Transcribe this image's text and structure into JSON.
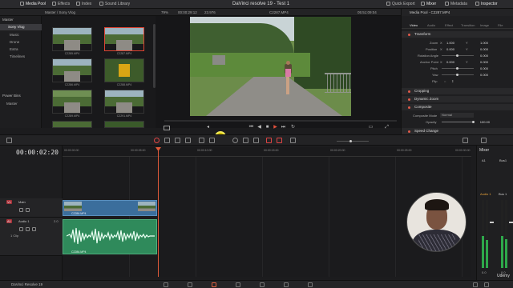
{
  "topbar": {
    "media_pool": "Media Pool",
    "effects": "Effects",
    "index": "Index",
    "sound_library": "Sound Library",
    "app_title": "DaVinci resolve 19 - Test 1",
    "quick_export": "Quick Export",
    "mixer": "Mixer",
    "metadata": "Metadata",
    "inspector": "Inspector"
  },
  "subbar": {
    "breadcrumb": "Master / Sony Vlog",
    "zoom": "79%",
    "timecode_in": "00:00:29:12",
    "fps": "23.976",
    "clip_name": "C2287.MP4",
    "timecode_out": "05:51:09:04"
  },
  "bins": {
    "master": "Master",
    "selected": "Sony Vlog",
    "items": [
      "Music",
      "Drone",
      "Extra",
      "Timelines"
    ],
    "power_bins": "Power Bins",
    "power_master": "Master"
  },
  "pool": {
    "thumbs": [
      "C2285.MP4",
      "C2287.MP4",
      "C2286.MP4",
      "C2288.MP4",
      "C2289.MP4",
      "C2291.MP4"
    ]
  },
  "inspector": {
    "header": "Media Pool - C2287.MP4",
    "tabs": [
      "Video",
      "Audio",
      "Effect",
      "Transition",
      "Image",
      "File"
    ],
    "transform": "Transform",
    "zoom_label": "Zoom",
    "zoom_x": "1.000",
    "zoom_y": "1.000",
    "position_label": "Position",
    "pos_x": "0.000",
    "pos_y": "0.000",
    "rotation_label": "Rotation Angle",
    "rotation": "0.000",
    "anchor_label": "Anchor Point",
    "anchor_x": "0.000",
    "anchor_y": "0.000",
    "pitch_label": "Pitch",
    "pitch": "0.000",
    "yaw_label": "Yaw",
    "yaw": "0.000",
    "flip_label": "Flip",
    "cropping": "Cropping",
    "dynamic_zoom": "Dynamic Zoom",
    "composite": "Composite",
    "comp_mode_label": "Composite Mode",
    "comp_mode": "Normal",
    "opacity_label": "Opacity",
    "opacity": "100.00",
    "speed_change": "Speed Change"
  },
  "timeline": {
    "timecode": "00:00:02:20",
    "ruler": [
      "00:00:00:00",
      "00:00:05:00",
      "00:00:10:00",
      "00:00:15:00",
      "00:00:20:00",
      "00:00:25:00",
      "00:00:30:00"
    ],
    "video_track_tag": "V1",
    "video_track_name": "Main",
    "audio_track_tag": "A1",
    "audio_track_name": "Audio 1",
    "audio_clip_count": "1 Clip",
    "audio_level": "2.0",
    "video_clip": "C2286.MP4",
    "audio_clip": "C2286.MP4"
  },
  "mixer": {
    "title": "Mixer",
    "ch1": "A1",
    "ch2": "Bus1",
    "ch1_name": "Audio 1",
    "ch2_name": "Bus 1",
    "ch1_level": "0.0",
    "ch2_level": "0.0"
  },
  "bottombar": {
    "app": "DaVinci Resolve 19"
  },
  "watermark": "Udemy"
}
